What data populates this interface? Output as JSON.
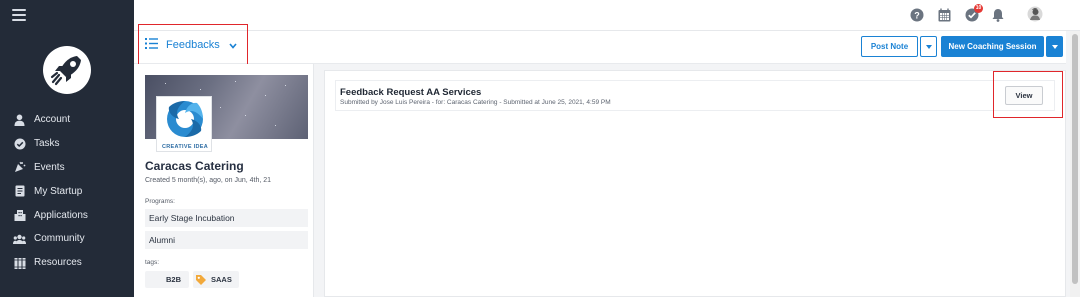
{
  "sidebar": {
    "items": [
      {
        "label": "Account",
        "icon": "user-icon"
      },
      {
        "label": "Tasks",
        "icon": "check-circle-icon"
      },
      {
        "label": "Events",
        "icon": "confetti-icon"
      },
      {
        "label": "My Startup",
        "icon": "document-icon"
      },
      {
        "label": "Applications",
        "icon": "building-icon"
      },
      {
        "label": "Community",
        "icon": "users-icon"
      },
      {
        "label": "Resources",
        "icon": "books-icon"
      }
    ]
  },
  "topbar": {
    "notification_count": "10",
    "icons": [
      "help-icon",
      "calendar-icon",
      "tasks-icon",
      "bell-icon",
      "avatar"
    ]
  },
  "header": {
    "view_label": "Feedbacks",
    "post_note_label": "Post Note",
    "new_session_label": "New Coaching Session"
  },
  "company": {
    "name": "Caracas Catering",
    "created": "Created 5 month(s), ago, on Jun, 4th, 21",
    "logo_text": "CREATIVE IDEA",
    "programs_label": "Programs:",
    "programs": [
      "Early Stage Incubation",
      "Alumni"
    ],
    "tags_label": "tags:",
    "tags": [
      "B2B",
      "SAAS"
    ]
  },
  "feedback": {
    "title": "Feedback Request AA Services",
    "subtitle": "Submitted by Jose Luis Pereira - for: Caracas Catering - Submitted at June 25, 2021, 4:59 PM",
    "view_label": "View"
  },
  "colors": {
    "sidebar_bg": "#232b38",
    "accent": "#1a82d4",
    "highlight_box": "#e0262b"
  }
}
